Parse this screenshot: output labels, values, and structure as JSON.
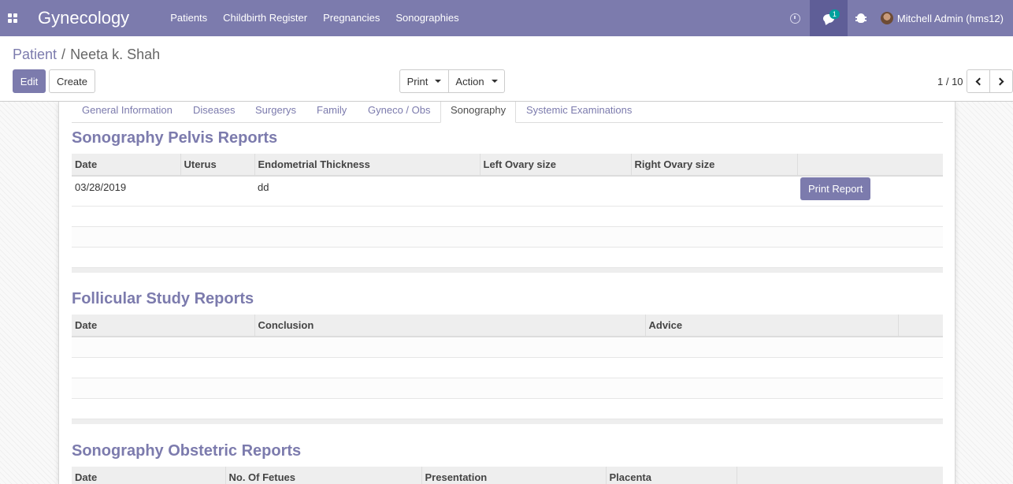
{
  "navbar": {
    "app_title": "Gynecology",
    "menu": [
      "Patients",
      "Childbirth Register",
      "Pregnancies",
      "Sonographies"
    ],
    "chat_badge": "1",
    "user_name": "Mitchell Admin (hms12)"
  },
  "breadcrumb": {
    "parent": "Patient",
    "separator": "/",
    "current": "Neeta k. Shah"
  },
  "buttons": {
    "edit": "Edit",
    "create": "Create",
    "print": "Print",
    "action": "Action"
  },
  "pager": {
    "value": "1 / 10"
  },
  "tabs": {
    "general": "General Information",
    "diseases": "Diseases",
    "surgerys": "Surgerys",
    "family": "Family",
    "gyneco": "Gyneco / Obs",
    "sonography": "Sonography",
    "systemic": "Systemic Examinations",
    "active": "Sonography"
  },
  "pelvis": {
    "title": "Sonography Pelvis Reports",
    "columns": [
      "Date",
      "Uterus",
      "Endometrial Thickness",
      "Left Ovary size",
      "Right Ovary size",
      ""
    ],
    "rows": [
      {
        "date": "03/28/2019",
        "uterus": "",
        "endometrial": "dd",
        "left_ovary": "",
        "right_ovary": "",
        "button": "Print Report"
      }
    ]
  },
  "follicular": {
    "title": "Follicular Study Reports",
    "columns": [
      "Date",
      "Conclusion",
      "Advice",
      ""
    ]
  },
  "obstetric": {
    "title": "Sonography Obstetric Reports",
    "columns": [
      "Date",
      "No. Of Fetues",
      "Presentation",
      "Placenta",
      ""
    ]
  },
  "colors": {
    "brand": "#7c7bad",
    "brand_dark": "#5f5e97",
    "badge": "#00a09d"
  }
}
